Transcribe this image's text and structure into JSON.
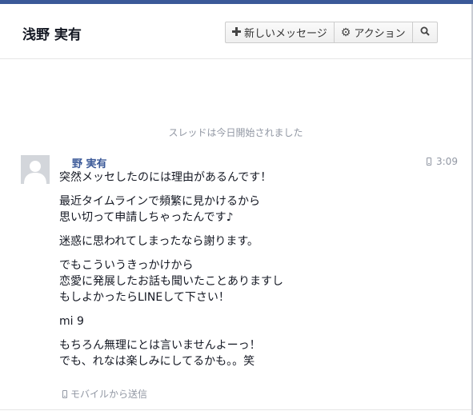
{
  "header": {
    "title": "浅野 実有",
    "buttons": {
      "new_message": "新しいメッセージ",
      "actions": "アクション"
    }
  },
  "thread_status": "スレッドは今日開始されました",
  "message": {
    "sender": "野 実有",
    "time": "3:09",
    "paragraphs": [
      "突然メッセしたのには理由があるんです！",
      "最近タイムラインで頻繁に見かけるから\n思い切って申請しちゃったんです♪",
      "迷惑に思われてしまったなら謝ります。",
      "でもこういうきっかけから\n恋愛に発展したお話も聞いたことありますし\nもしよかったらLINEして下さい！",
      "mi          9",
      "もちろん無理にとは言いませんよーっ！\nでも、れなは楽しみにしてるかも。。笑"
    ],
    "source": "モバイルから送信"
  },
  "icons": {
    "plus": "plus-icon",
    "gear": "gear-icon",
    "search": "search-icon",
    "mobile": "mobile-phone-icon",
    "avatar": "default-avatar"
  }
}
